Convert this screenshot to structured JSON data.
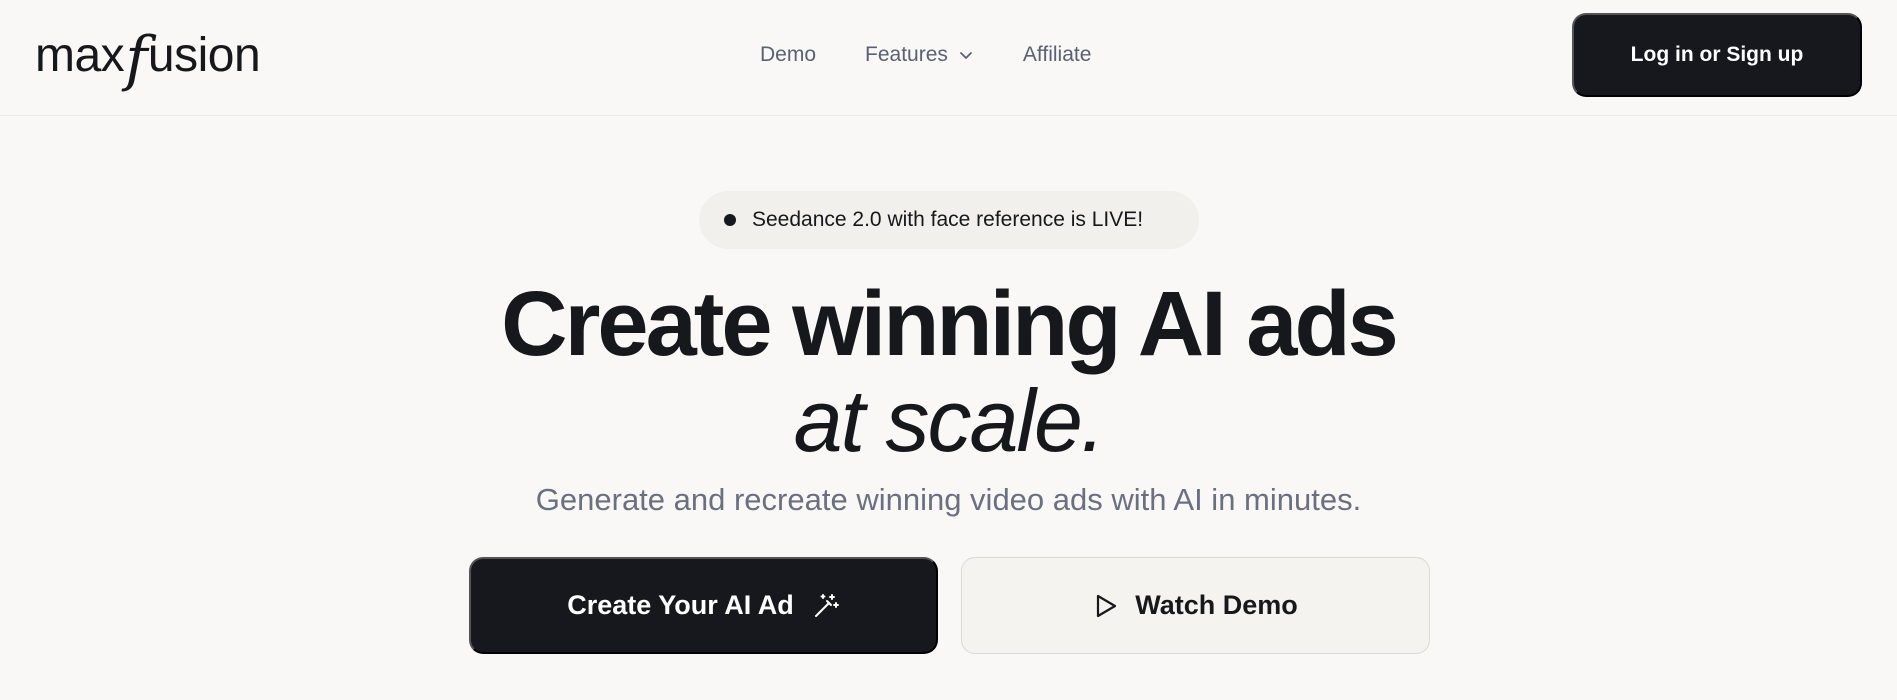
{
  "header": {
    "logo": {
      "part1": "max",
      "part2": "f",
      "part3": "usion"
    },
    "nav": [
      {
        "label": "Demo"
      },
      {
        "label": "Features",
        "icon": "chevron-down-icon"
      },
      {
        "label": "Affiliate"
      }
    ],
    "login_label": "Log in or Sign up"
  },
  "hero": {
    "badge": "Seedance 2.0 with face reference is LIVE!",
    "headline_line1": "Create winning AI ads",
    "headline_line2": "at scale.",
    "subtitle": "Generate and recreate winning video ads with AI in minutes.",
    "primary_cta": {
      "label": "Create Your AI Ad",
      "icon": "magic-wand-icon"
    },
    "secondary_cta": {
      "label": "Watch Demo",
      "icon": "play-icon"
    }
  },
  "colors": {
    "background": "#f9f8f6",
    "dark": "#17181e",
    "muted_text": "#6b7080",
    "nav_text": "#5b6072"
  }
}
